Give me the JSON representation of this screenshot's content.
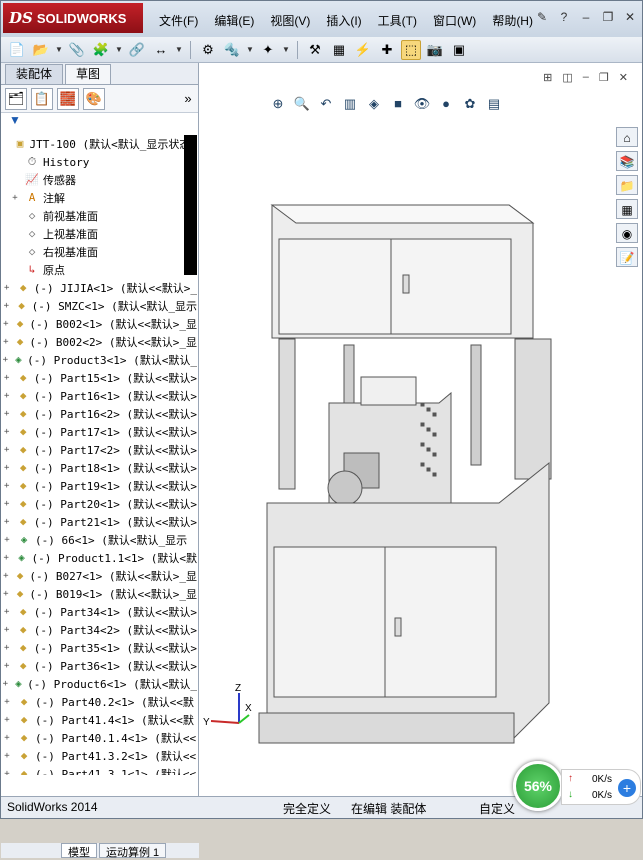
{
  "app": {
    "logo_prefix": "DS",
    "logo_text": "SOLIDWORKS"
  },
  "menu": [
    "文件(F)",
    "编辑(E)",
    "视图(V)",
    "插入(I)",
    "工具(T)",
    "窗口(W)",
    "帮助(H)"
  ],
  "panel": {
    "tabs": [
      "装配体",
      "草图"
    ],
    "filter_icon": "filter-icon"
  },
  "tree": [
    {
      "exp": "",
      "ico": "assembly",
      "text": "JTT-100  (默认<默认_显示状态-"
    },
    {
      "exp": "",
      "ico": "history",
      "text": "History"
    },
    {
      "exp": "",
      "ico": "sensor",
      "text": "传感器"
    },
    {
      "exp": "+",
      "ico": "annotation",
      "text": "注解"
    },
    {
      "exp": "",
      "ico": "plane",
      "text": "前视基准面"
    },
    {
      "exp": "",
      "ico": "plane",
      "text": "上视基准面"
    },
    {
      "exp": "",
      "ico": "plane",
      "text": "右视基准面"
    },
    {
      "exp": "",
      "ico": "origin",
      "text": "原点"
    },
    {
      "exp": "+",
      "ico": "part",
      "text": "(-) JIJIA<1> (默认<<默认>_"
    },
    {
      "exp": "+",
      "ico": "part",
      "text": "(-) SMZC<1> (默认<默认_显示"
    },
    {
      "exp": "+",
      "ico": "part",
      "text": "(-) B002<1> (默认<<默认>_显"
    },
    {
      "exp": "+",
      "ico": "part",
      "text": "(-) B002<2> (默认<<默认>_显"
    },
    {
      "exp": "+",
      "ico": "asm",
      "text": "(-) Product3<1> (默认<默认_"
    },
    {
      "exp": "+",
      "ico": "part",
      "text": "(-) Part15<1> (默认<<默认>"
    },
    {
      "exp": "+",
      "ico": "part",
      "text": "(-) Part16<1> (默认<<默认>"
    },
    {
      "exp": "+",
      "ico": "part",
      "text": "(-) Part16<2> (默认<<默认>"
    },
    {
      "exp": "+",
      "ico": "part",
      "text": "(-) Part17<1> (默认<<默认>"
    },
    {
      "exp": "+",
      "ico": "part",
      "text": "(-) Part17<2> (默认<<默认>"
    },
    {
      "exp": "+",
      "ico": "part",
      "text": "(-) Part18<1> (默认<<默认>"
    },
    {
      "exp": "+",
      "ico": "part",
      "text": "(-) Part19<1> (默认<<默认>"
    },
    {
      "exp": "+",
      "ico": "part",
      "text": "(-) Part20<1> (默认<<默认>"
    },
    {
      "exp": "+",
      "ico": "part",
      "text": "(-) Part21<1> (默认<<默认>"
    },
    {
      "exp": "+",
      "ico": "asm",
      "text": "(-) 66<1> (默认<默认_显示"
    },
    {
      "exp": "+",
      "ico": "asm",
      "text": "(-) Product1.1<1> (默认<默"
    },
    {
      "exp": "+",
      "ico": "part",
      "text": "(-) B027<1> (默认<<默认>_显"
    },
    {
      "exp": "+",
      "ico": "part",
      "text": "(-) B019<1> (默认<<默认>_显"
    },
    {
      "exp": "+",
      "ico": "part",
      "text": "(-) Part34<1> (默认<<默认>"
    },
    {
      "exp": "+",
      "ico": "part",
      "text": "(-) Part34<2> (默认<<默认>"
    },
    {
      "exp": "+",
      "ico": "part",
      "text": "(-) Part35<1> (默认<<默认>"
    },
    {
      "exp": "+",
      "ico": "part",
      "text": "(-) Part36<1> (默认<<默认>"
    },
    {
      "exp": "+",
      "ico": "asm",
      "text": "(-) Product6<1> (默认<默认_"
    },
    {
      "exp": "+",
      "ico": "part",
      "text": "(-) Part40.2<1> (默认<<默"
    },
    {
      "exp": "+",
      "ico": "part",
      "text": "(-) Part41.4<1> (默认<<默"
    },
    {
      "exp": "+",
      "ico": "part",
      "text": "(-) Part40.1.4<1> (默认<<"
    },
    {
      "exp": "+",
      "ico": "part",
      "text": "(-) Part41.3.2<1> (默认<<"
    },
    {
      "exp": "+",
      "ico": "part",
      "text": "(-) Part41.3.1<1> (默认<<"
    }
  ],
  "bottom_tabs": [
    "模型",
    "运动算例 1"
  ],
  "status": {
    "app": "SolidWorks 2014",
    "def": "完全定义",
    "edit": "在编辑 装配体",
    "custom": "自定义"
  },
  "perf": {
    "percent": "56%",
    "up": "0K/s",
    "down": "0K/s"
  },
  "axis": {
    "x": "X",
    "y": "Y",
    "z": "Z"
  }
}
